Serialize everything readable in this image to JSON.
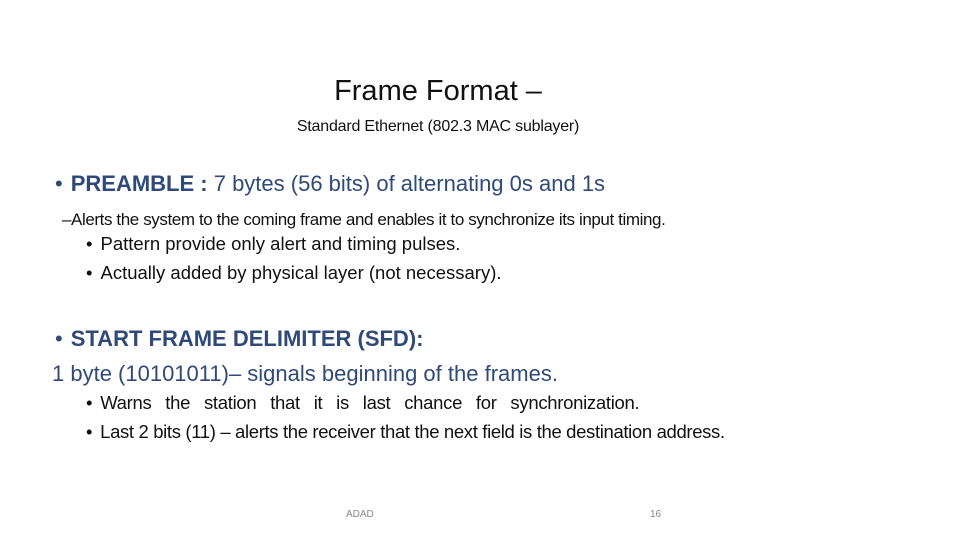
{
  "slide": {
    "title": "Frame Format –",
    "subtitle": "Standard Ethernet (802.3 MAC sublayer)",
    "preamble": {
      "bullet": "•",
      "label": "PREAMBLE :",
      "text": "7 bytes (56 bits) of alternating 0s and 1s",
      "note": "–Alerts the system to the coming frame and enables it to synchronize its input timing.",
      "sub_items": [
        "Pattern provide only alert and timing pulses.",
        "Actually added by physical layer (not necessary)."
      ]
    },
    "sfd": {
      "bullet": "•",
      "label": "START FRAME DELIMITER (SFD):",
      "text": "1 byte (10101011)–  signals beginning of the frames.",
      "sub_items": [
        "Warns the station that it is last chance for synchronization.",
        "Last 2 bits (11) – alerts the receiver that the next field is  the destination address."
      ]
    },
    "sub_bullet": "•",
    "footer": {
      "left": "ADAD",
      "page_number": "16"
    },
    "colors": {
      "accent_text": "#2f4a78",
      "body_text": "#111111",
      "footer_text": "#888888"
    }
  }
}
